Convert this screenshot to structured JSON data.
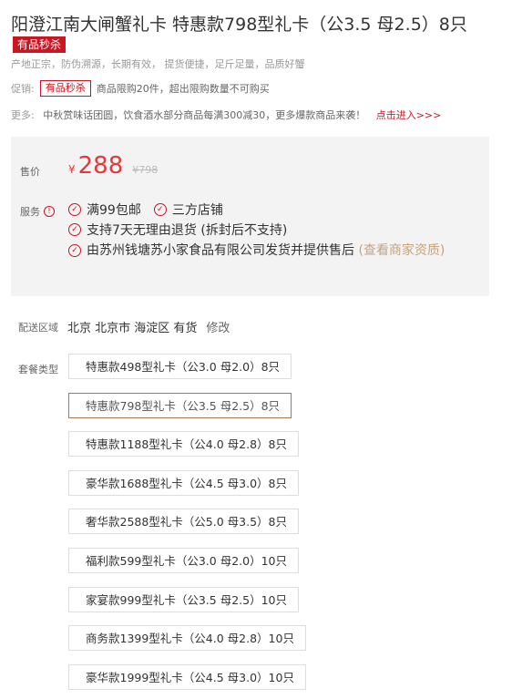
{
  "product": {
    "title": "阳澄江南大闸蟹礼卡 特惠款798型礼卡（公3.5 母2.5）8只",
    "tag": "有品秒杀",
    "subtitle": "产地正宗，防伪溯源，长期有效， 提货便捷，足斤足量，品质好蟹"
  },
  "promo": {
    "label": "促销:",
    "tag": "有品秒杀",
    "text": "商品限购20件，超出限购数量不可购买"
  },
  "more": {
    "label": "更多:",
    "text": "中秋赏味话团圆，饮食酒水部分商品每满300减30，更多爆款商品来袭！",
    "link": "点击进入>>>"
  },
  "price": {
    "label": "售价",
    "currency": "¥",
    "value": "288",
    "original": "¥798"
  },
  "service": {
    "label": "服务",
    "items": [
      "满99包邮",
      "三方店铺",
      "支持7天无理由退货 (拆封后不支持)"
    ],
    "seller_text": "由苏州钱塘苏小家食品有限公司发货并提供售后",
    "seller_link": "(查看商家资质)"
  },
  "delivery": {
    "label": "配送区域",
    "region": "北京 北京市 海淀区",
    "stock": "有货",
    "edit": "修改"
  },
  "packages": {
    "label": "套餐类型",
    "selected_index": 1,
    "options": [
      "特惠款498型礼卡（公3.0 母2.0）8只",
      "特惠款798型礼卡（公3.5 母2.5）8只",
      "特惠款1188型礼卡（公4.0 母2.8）8只",
      "豪华款1688型礼卡（公4.5 母3.0）8只",
      "奢华款2588型礼卡（公5.0 母3.5）8只",
      "福利款599型礼卡（公3.0 母2.0）10只",
      "家宴款999型礼卡（公3.5 母2.5）10只",
      "商务款1399型礼卡（公4.0 母2.8）10只",
      "豪华款1999型礼卡（公4.5 母3.0）10只"
    ]
  },
  "colors": {
    "accent_red": "#c81623",
    "price_red": "#e4393c",
    "link_gold": "#c8a27a",
    "selected_border": "#a0785a"
  }
}
